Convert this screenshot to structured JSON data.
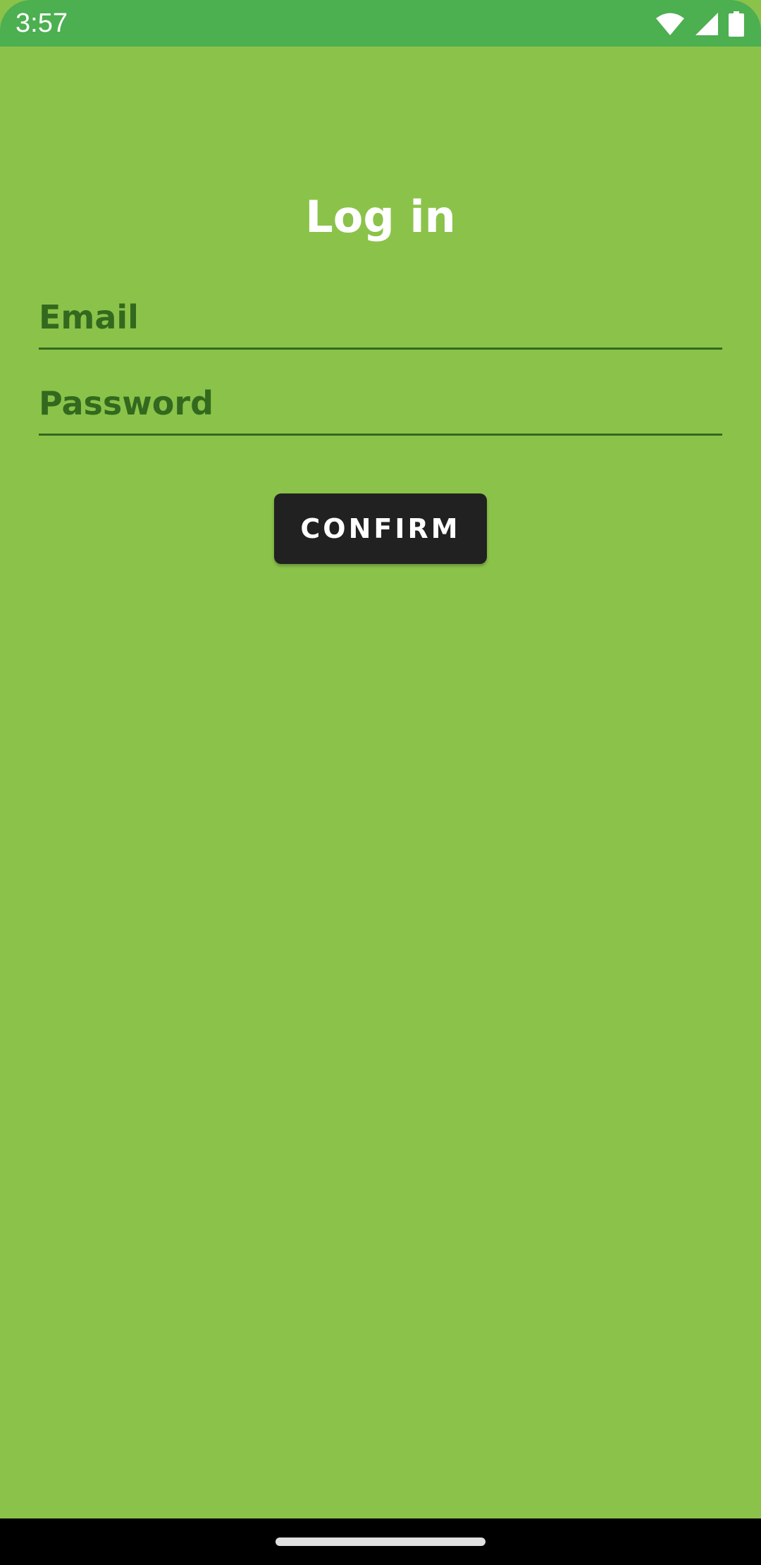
{
  "status_bar": {
    "time": "3:57",
    "icons": [
      "wifi-icon",
      "cell-signal-icon",
      "battery-icon"
    ],
    "color": "#4caf50"
  },
  "screen": {
    "title": "Log in",
    "background_color": "#8bc34a"
  },
  "form": {
    "email": {
      "placeholder": "Email",
      "value": ""
    },
    "password": {
      "placeholder": "Password",
      "value": ""
    },
    "confirm_label": "CONFIRM"
  },
  "colors": {
    "field_text": "#33691e",
    "button_bg": "#212121",
    "title_text": "#ffffff"
  }
}
